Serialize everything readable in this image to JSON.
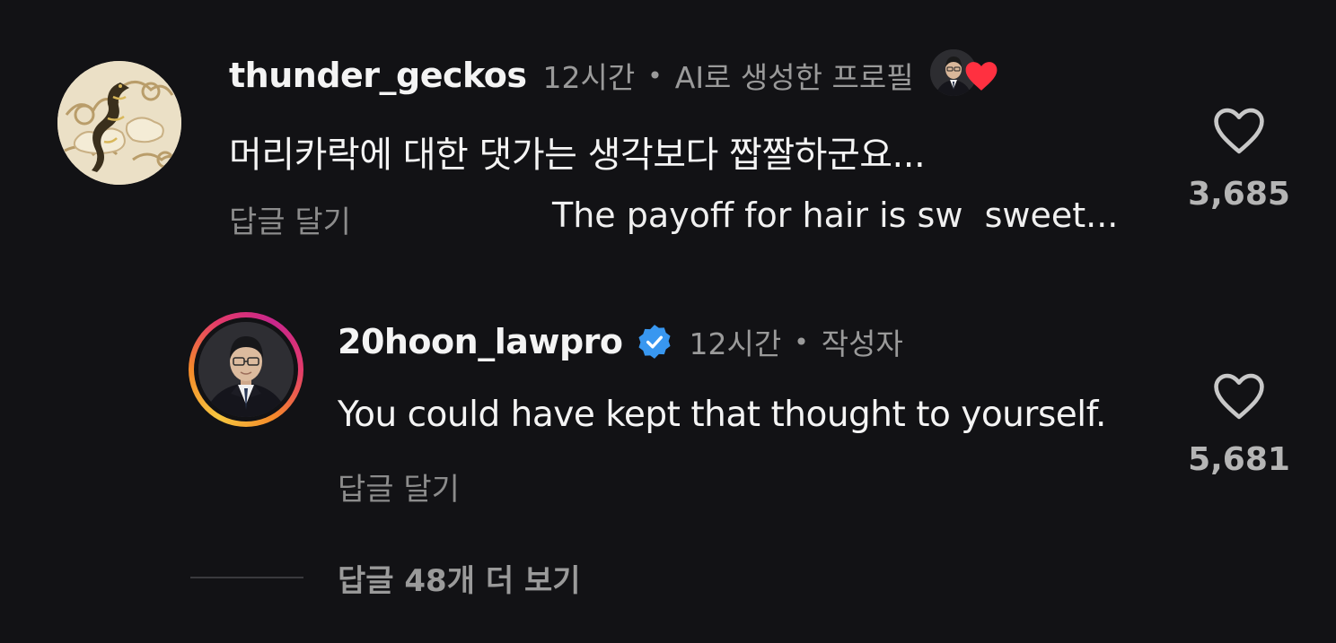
{
  "comments": [
    {
      "username": "thunder_geckos",
      "time": "12시간",
      "badge_text": "AI로 생성한 프로필",
      "text": "머리카락에 대한 댓가는 생각보다 짭짤하군요...",
      "reply_label": "답글 달기",
      "translation": "The payoff for hair is sw  sweet...",
      "likes": "3,685",
      "avatar_icon": "gecko-cloud-avatar",
      "liked_by_author": true
    },
    {
      "username": "20hoon_lawpro",
      "verified": true,
      "time": "12시간",
      "role": "작성자",
      "text": "You could have kept that thought to yourself.",
      "reply_label": "답글 달기",
      "likes": "5,681",
      "avatar_icon": "man-in-suit-avatar"
    }
  ],
  "view_more_label": "답글 48개 더 보기",
  "colors": {
    "background": "#121215",
    "primary_text": "#f4f4f4",
    "secondary_text": "#9a9a9a",
    "verified_blue": "#3897f0",
    "heart_red": "#ff3040"
  }
}
